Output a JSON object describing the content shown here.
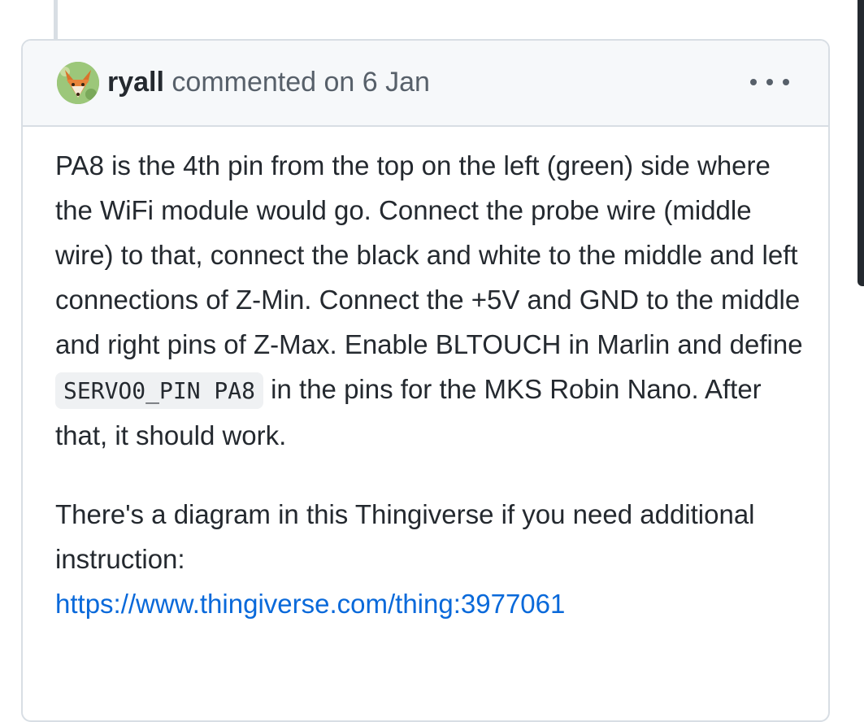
{
  "comment": {
    "author": "ryall",
    "action": "commented on 6 Jan",
    "more_label": "...",
    "body": {
      "p1_before_code": "PA8 is the 4th pin from the top on the left (green) side where the WiFi module would go. Connect the probe wire (middle wire) to that, connect the black and white to the middle and left connections of Z-Min. Connect the +5V and GND to the middle and right pins of Z-Max. Enable BLTOUCH in Marlin and define ",
      "p1_code": "SERVO0_PIN PA8",
      "p1_after_code": " in the pins for the MKS Robin Nano. After that, it should work.",
      "p2_text": "There's a diagram in this Thingiverse if you need additional instruction:",
      "p2_link": "https://www.thingiverse.com/thing:3977061"
    }
  },
  "colors": {
    "link": "#0969da",
    "text": "#24292f",
    "muted": "#57606a",
    "header_bg": "#f6f8fa",
    "border": "#d8dee4"
  },
  "icons": {
    "avatar": "fox-avatar-icon",
    "more": "kebab-horizontal-icon"
  }
}
